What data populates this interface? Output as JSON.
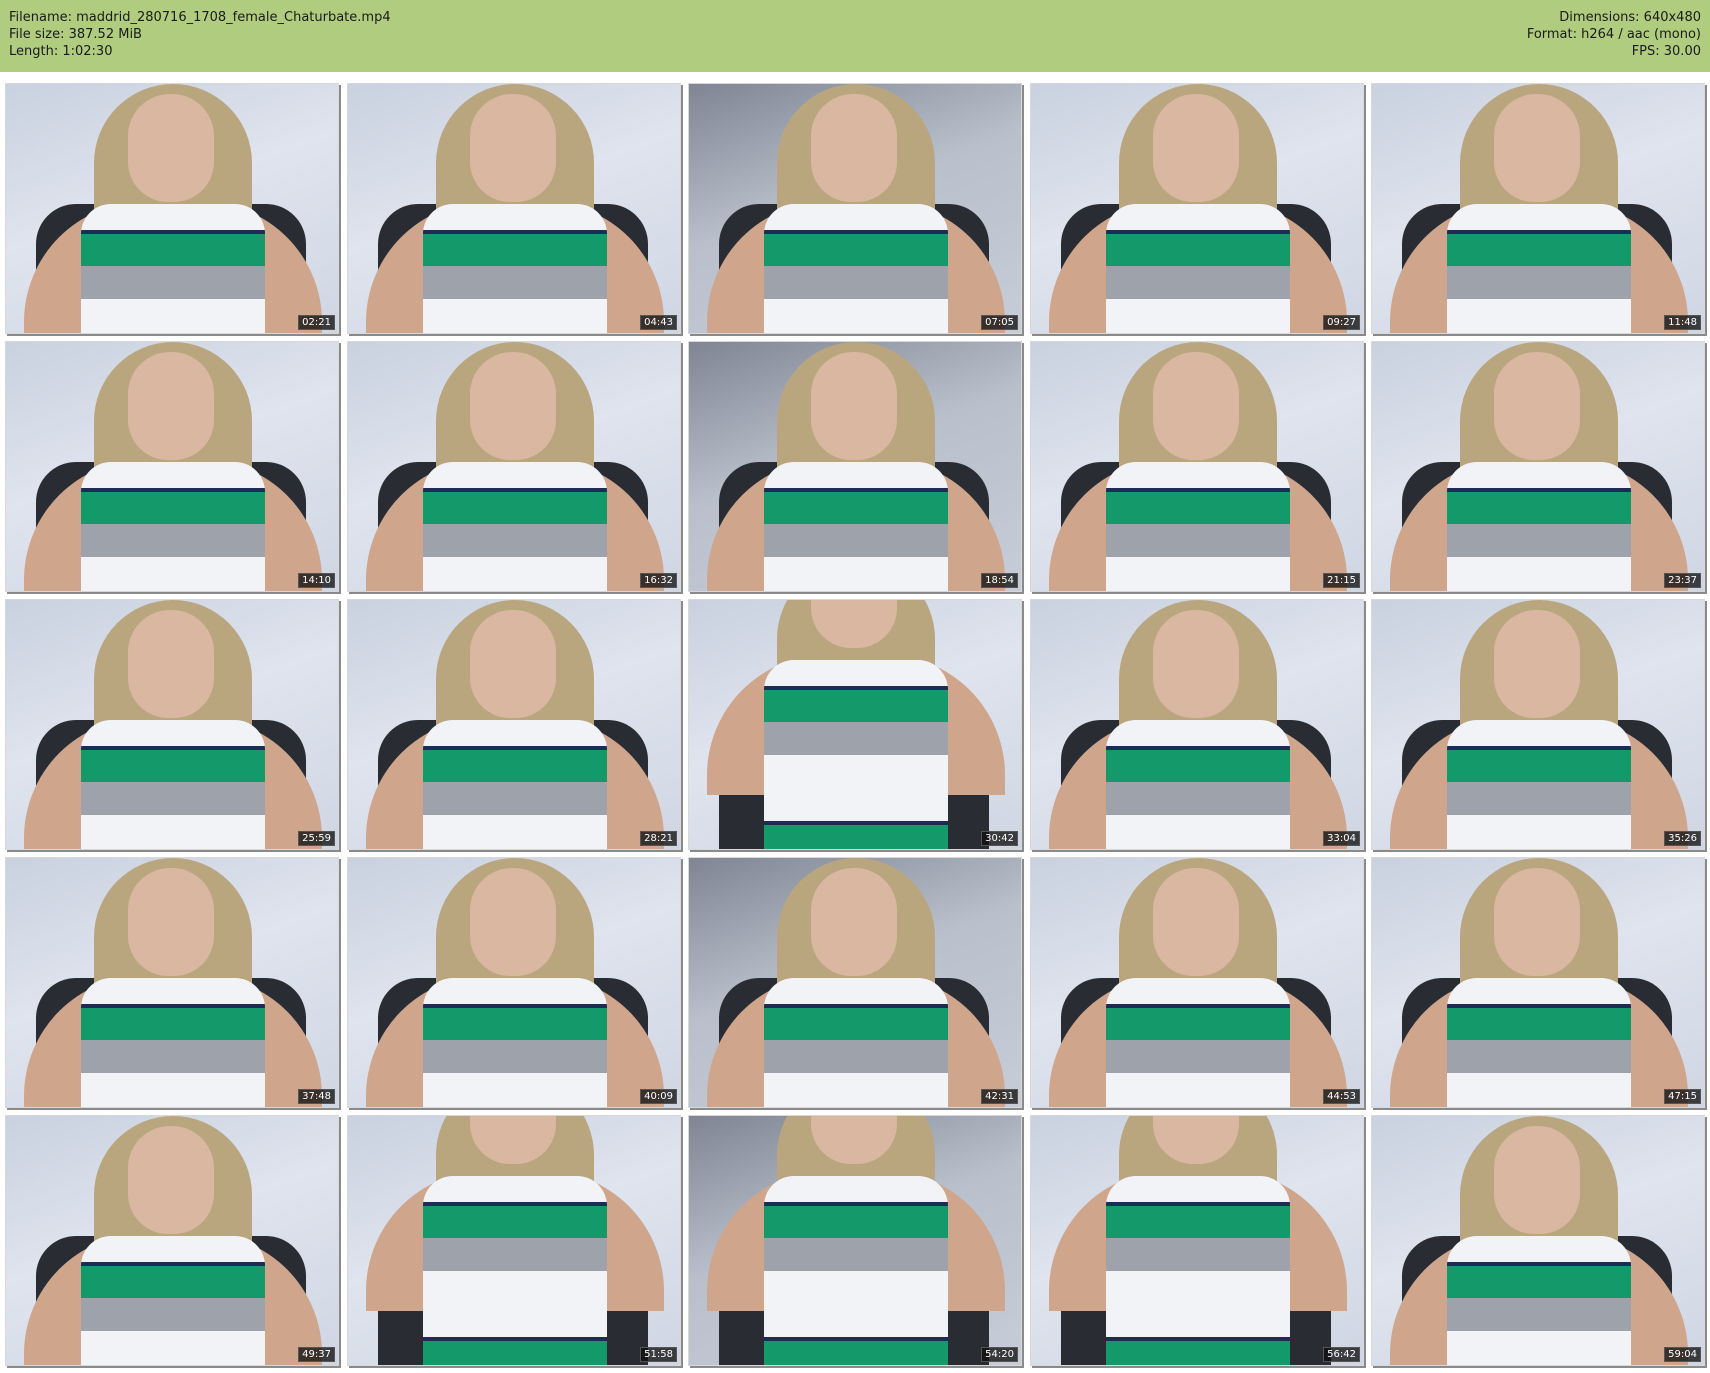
{
  "header": {
    "filename_label": "Filename: maddrid_280716_1708_female_Chaturbate.mp4",
    "filesize_label": "File size: 387.52 MiB",
    "length_label": "Length: 1:02:30",
    "dimensions_label": "Dimensions: 640x480",
    "format_label": "Format: h264 / aac (mono)",
    "fps_label": "FPS: 30.00",
    "background_color": "#b0cd7f"
  },
  "thumbnails": [
    {
      "time": "02:21"
    },
    {
      "time": "04:43"
    },
    {
      "time": "07:05"
    },
    {
      "time": "09:27"
    },
    {
      "time": "11:48"
    },
    {
      "time": "14:10"
    },
    {
      "time": "16:32"
    },
    {
      "time": "18:54"
    },
    {
      "time": "21:15"
    },
    {
      "time": "23:37"
    },
    {
      "time": "25:59"
    },
    {
      "time": "28:21"
    },
    {
      "time": "30:42"
    },
    {
      "time": "33:04"
    },
    {
      "time": "35:26"
    },
    {
      "time": "37:48"
    },
    {
      "time": "40:09"
    },
    {
      "time": "42:31"
    },
    {
      "time": "44:53"
    },
    {
      "time": "47:15"
    },
    {
      "time": "49:37"
    },
    {
      "time": "51:58"
    },
    {
      "time": "54:20"
    },
    {
      "time": "56:42"
    },
    {
      "time": "59:04"
    }
  ]
}
